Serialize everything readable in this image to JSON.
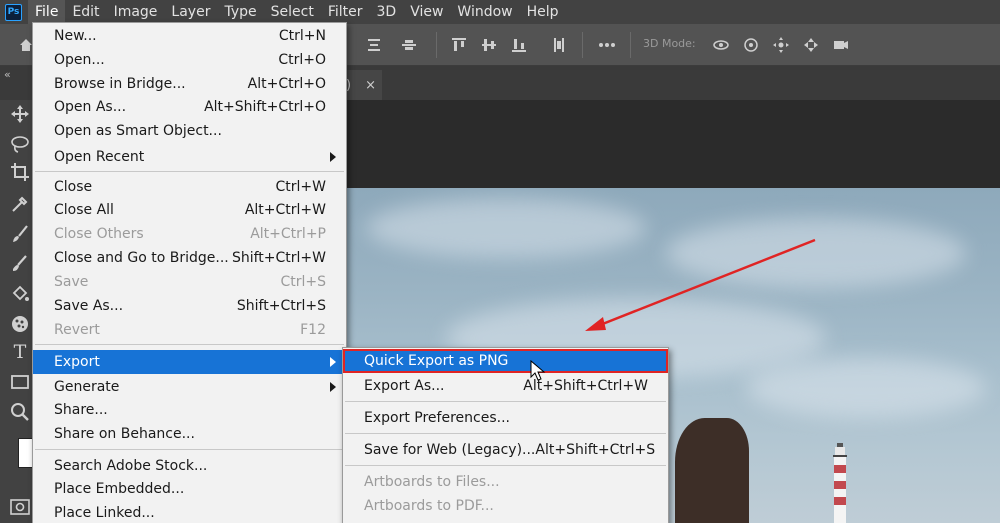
{
  "menubar": {
    "app_icon": "Ps",
    "items": [
      "File",
      "Edit",
      "Image",
      "Layer",
      "Type",
      "Select",
      "Filter",
      "3D",
      "View",
      "Window",
      "Help"
    ],
    "active": "File"
  },
  "optionsbar": {
    "mode3d_label": "3D Mode:",
    "icons": [
      "home-icon",
      "align-left-edges-icon",
      "align-horizontal-centers-icon",
      "align-top-edges-icon",
      "align-vertical-centers-icon",
      "align-bottom-edges-icon",
      "distribute-icon",
      "more-options-icon",
      "orbit-3d-icon",
      "roll-3d-icon",
      "drag-3d-icon",
      "slide-3d-icon",
      "camera-3d-icon"
    ]
  },
  "tabrow": {
    "collapse_glyph": "«",
    "doc_tab_text": ")",
    "doc_tab_close": "×"
  },
  "tools": [
    "move-tool-icon",
    "lasso-tool-icon",
    "crop-tool-icon",
    "eyedropper-tool-icon",
    "brush-tool-icon",
    "clone-stamp-tool-icon",
    "paint-bucket-tool-icon",
    "blur-tool-icon",
    "type-tool-icon",
    "rectangle-tool-icon",
    "zoom-tool-icon"
  ],
  "type_tool_glyph": "T",
  "file_menu": {
    "items": [
      {
        "label": "New...",
        "shortcut": "Ctrl+N"
      },
      {
        "label": "Open...",
        "shortcut": "Ctrl+O"
      },
      {
        "label": "Browse in Bridge...",
        "shortcut": "Alt+Ctrl+O"
      },
      {
        "label": "Open As...",
        "shortcut": "Alt+Shift+Ctrl+O"
      },
      {
        "label": "Open as Smart Object...",
        "shortcut": ""
      },
      {
        "label": "Open Recent",
        "shortcut": ""
      },
      {
        "label": "Close",
        "shortcut": "Ctrl+W"
      },
      {
        "label": "Close All",
        "shortcut": "Alt+Ctrl+W"
      },
      {
        "label": "Close Others",
        "shortcut": "Alt+Ctrl+P"
      },
      {
        "label": "Close and Go to Bridge...",
        "shortcut": "Shift+Ctrl+W"
      },
      {
        "label": "Save",
        "shortcut": "Ctrl+S"
      },
      {
        "label": "Save As...",
        "shortcut": "Shift+Ctrl+S"
      },
      {
        "label": "Revert",
        "shortcut": "F12"
      },
      {
        "label": "Export",
        "shortcut": ""
      },
      {
        "label": "Generate",
        "shortcut": ""
      },
      {
        "label": "Share...",
        "shortcut": ""
      },
      {
        "label": "Share on Behance...",
        "shortcut": ""
      },
      {
        "label": "Search Adobe Stock...",
        "shortcut": ""
      },
      {
        "label": "Place Embedded...",
        "shortcut": ""
      },
      {
        "label": "Place Linked...",
        "shortcut": ""
      }
    ]
  },
  "export_submenu": {
    "items": [
      {
        "label": "Quick Export as PNG",
        "shortcut": ""
      },
      {
        "label": "Export As...",
        "shortcut": "Alt+Shift+Ctrl+W"
      },
      {
        "label": "Export Preferences...",
        "shortcut": ""
      },
      {
        "label": "Save for Web (Legacy)...",
        "shortcut": "Alt+Shift+Ctrl+S"
      },
      {
        "label": "Artboards to Files...",
        "shortcut": ""
      },
      {
        "label": "Artboards to PDF...",
        "shortcut": ""
      }
    ]
  },
  "colors": {
    "highlight": "#1773d6",
    "annotation": "#e02424"
  }
}
